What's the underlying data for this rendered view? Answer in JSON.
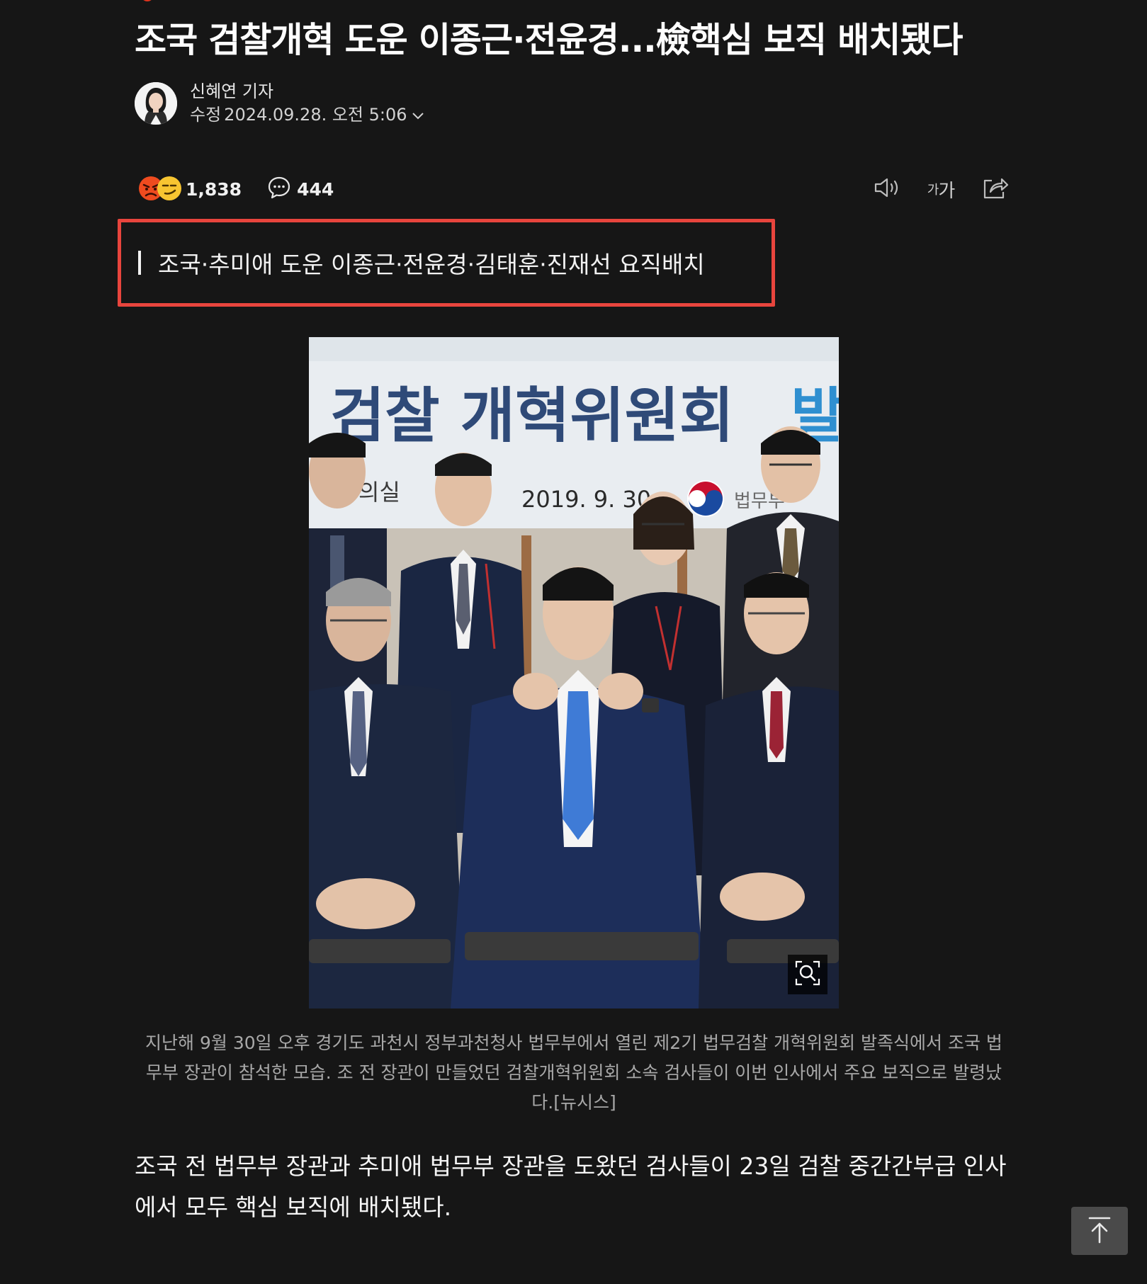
{
  "article": {
    "title": "조국 검찰개혁 도운 이종근·전윤경...檢핵심 보직 배치됐다",
    "subtitle": "조국·추미애 도운 이종근·전윤경·김태훈·진재선 요직배치",
    "author": {
      "name": "신혜연 기자",
      "date_prefix": "수정",
      "date": "2024.09.28. 오전 5:06"
    },
    "reactions": {
      "count": "1,838",
      "icons": [
        "angry-face-icon",
        "smirk-face-icon"
      ]
    },
    "comments": {
      "count": "444",
      "icon": "speech-bubble-icon"
    },
    "tools": {
      "audio_icon": "speaker-icon",
      "font_size_label_small": "가",
      "font_size_label_large": "가",
      "share_icon": "share-icon"
    },
    "photo": {
      "banner_text": "검찰 개혁위원회",
      "banner_accent_text": "발",
      "banner_room": "의실",
      "banner_date": "2019. 9. 30",
      "banner_ministry": "법무부",
      "zoom_icon": "magnifier-icon"
    },
    "caption": "지난해 9월 30일 오후 경기도 과천시 정부과천청사 법무부에서 열린 제2기 법무검찰 개혁위원회 발족식에서 조국 법무부 장관이 참석한 모습. 조 전 장관이 만들었던 검찰개혁위원회 소속 검사들이 이번 인사에서 주요 보직으로 발령났다.[뉴시스]",
    "body": "조국 전 법무부 장관과 추미애 법무부 장관을 도왔던 검사들이 23일 검찰 중간간부급 인사에서 모두 핵심 보직에 배치됐다."
  },
  "colors": {
    "background": "#161616",
    "highlight_border": "#e8453d",
    "accent_red": "#e1341e"
  },
  "scroll_top_icon": "arrow-up-icon"
}
